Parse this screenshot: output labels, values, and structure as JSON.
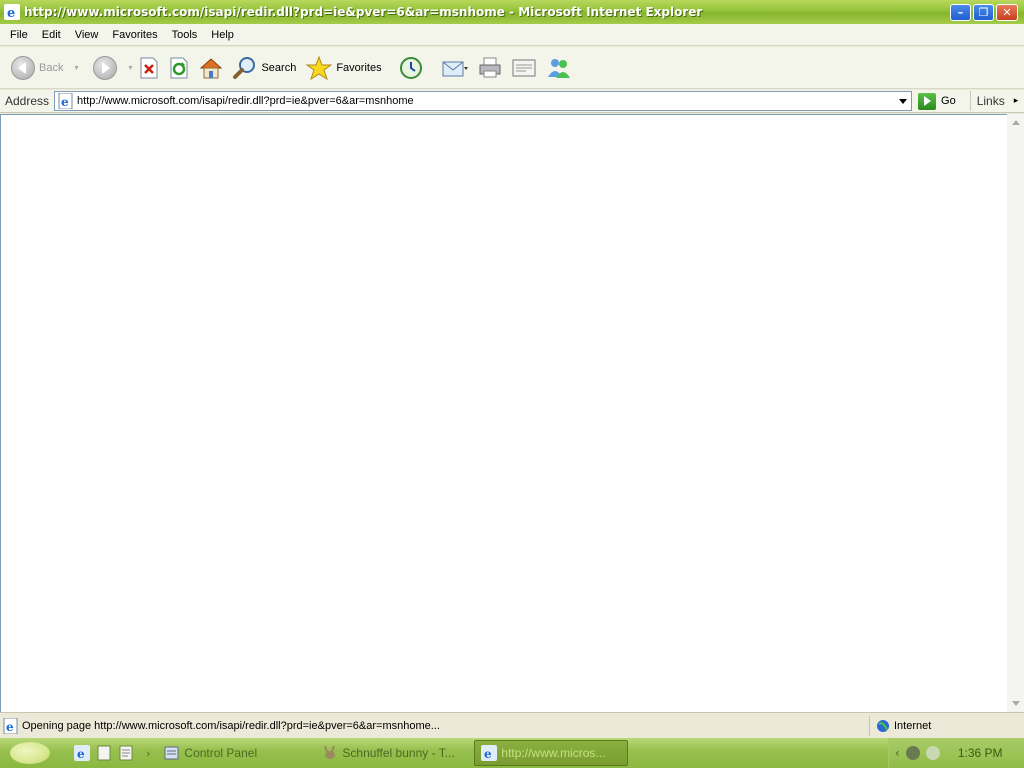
{
  "window": {
    "title": "http://www.microsoft.com/isapi/redir.dll?prd=ie&pver=6&ar=msnhome - Microsoft Internet Explorer",
    "minimize": "–",
    "restore": "❐",
    "close": "✕"
  },
  "menu": {
    "items": [
      "File",
      "Edit",
      "View",
      "Favorites",
      "Tools",
      "Help"
    ]
  },
  "toolbar": {
    "back_label": "Back",
    "search_label": "Search",
    "favorites_label": "Favorites",
    "icons": [
      "back-icon",
      "forward-icon",
      "stop-icon",
      "refresh-icon",
      "home-icon",
      "search-icon",
      "favorites-icon",
      "history-icon",
      "mail-icon",
      "print-icon",
      "edit-icon",
      "messenger-icon"
    ]
  },
  "address": {
    "label": "Address",
    "url": "http://www.microsoft.com/isapi/redir.dll?prd=ie&pver=6&ar=msnhome",
    "go_label": "Go",
    "links_label": "Links"
  },
  "status": {
    "text": "Opening page http://www.microsoft.com/isapi/redir.dll?prd=ie&pver=6&ar=msnhome...",
    "zone": "Internet"
  },
  "taskbar": {
    "tasks": [
      {
        "label": "Control Panel"
      },
      {
        "label": "Schnuffel bunny - T..."
      },
      {
        "label": "http://www.micros..."
      }
    ],
    "clock": "1:36 PM"
  },
  "colors": {
    "titlebar": "#93c23a",
    "taskbar": "#98c050",
    "address_border": "#7f9db9"
  }
}
